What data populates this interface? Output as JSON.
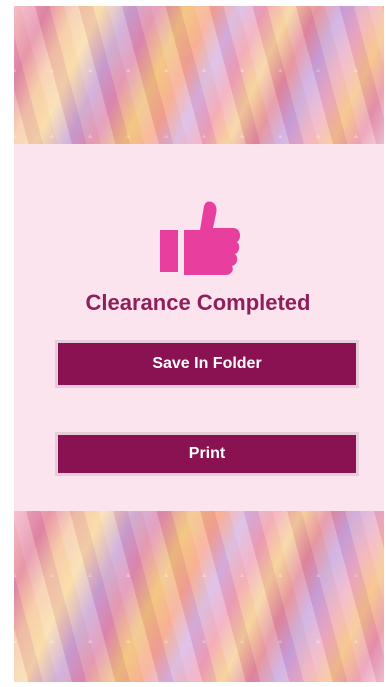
{
  "screen": {
    "title": "Clearance Completed",
    "icon": "thumbs-up-icon",
    "buttons": {
      "save_label": "Save In Folder",
      "print_label": "Print"
    }
  },
  "colors": {
    "accent": "#8a1152",
    "title": "#8f1e5a",
    "icon": "#e83e9e",
    "panel": "#fbe4ee"
  }
}
